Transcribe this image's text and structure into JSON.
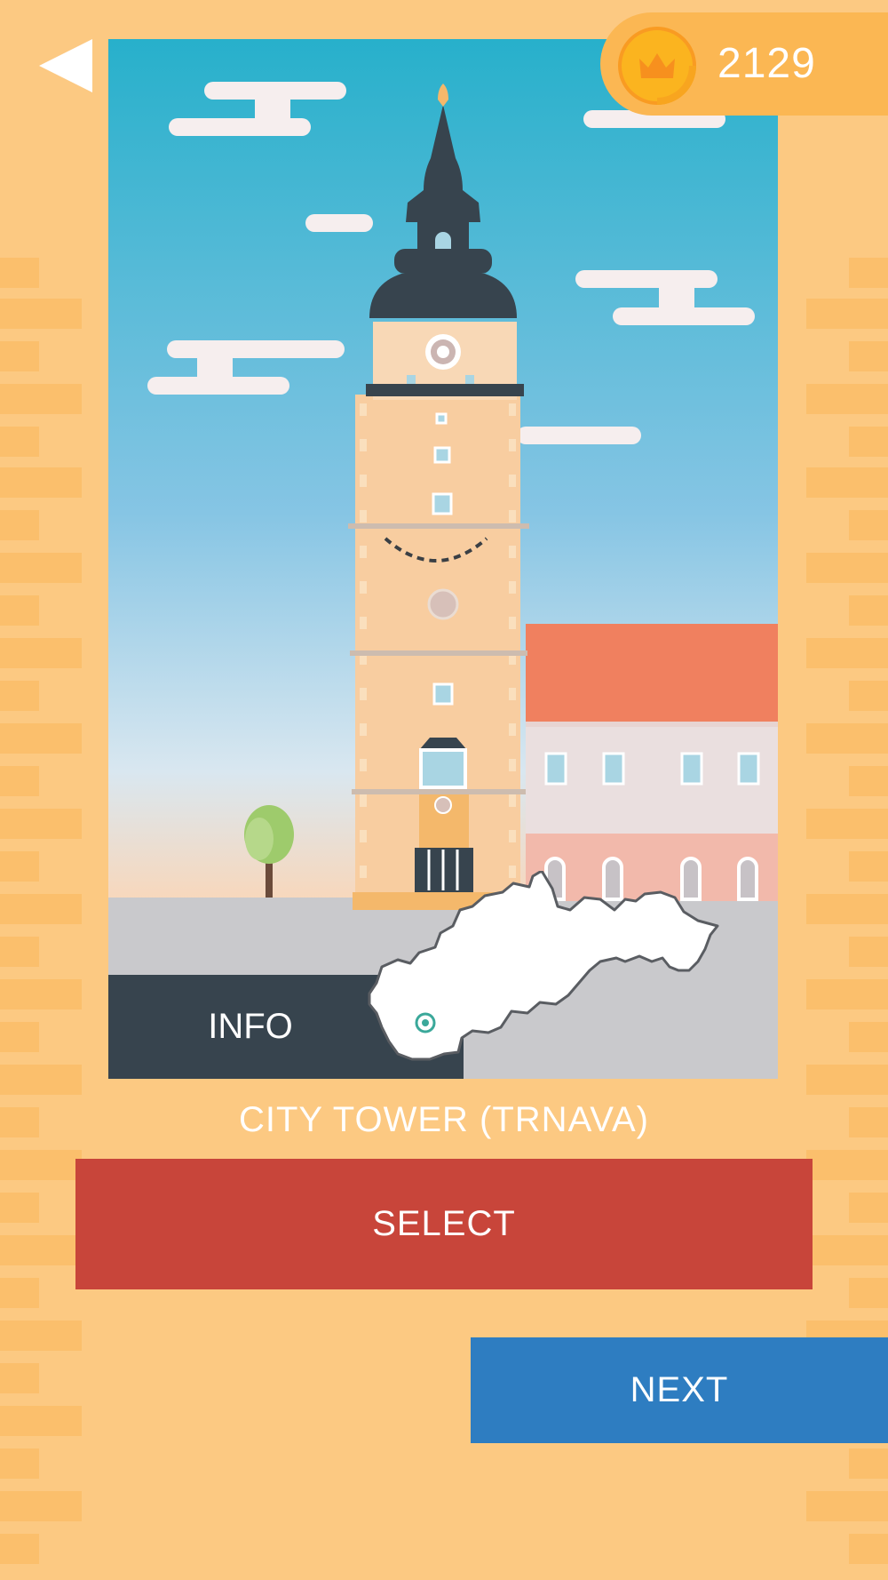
{
  "header": {
    "back_icon": "back-arrow-icon",
    "coins": {
      "icon": "crown-coin-icon",
      "count": "2129"
    }
  },
  "card": {
    "info_label": "INFO",
    "map_icon": "slovakia-map-icon",
    "landmark_name": "CITY TOWER (TRNAVA)"
  },
  "actions": {
    "select_label": "SELECT",
    "next_label": "NEXT"
  },
  "colors": {
    "background": "#fcc982",
    "select": "#c8453a",
    "next": "#2e7dc1",
    "info": "#37444e",
    "coin": "#fbb753"
  }
}
